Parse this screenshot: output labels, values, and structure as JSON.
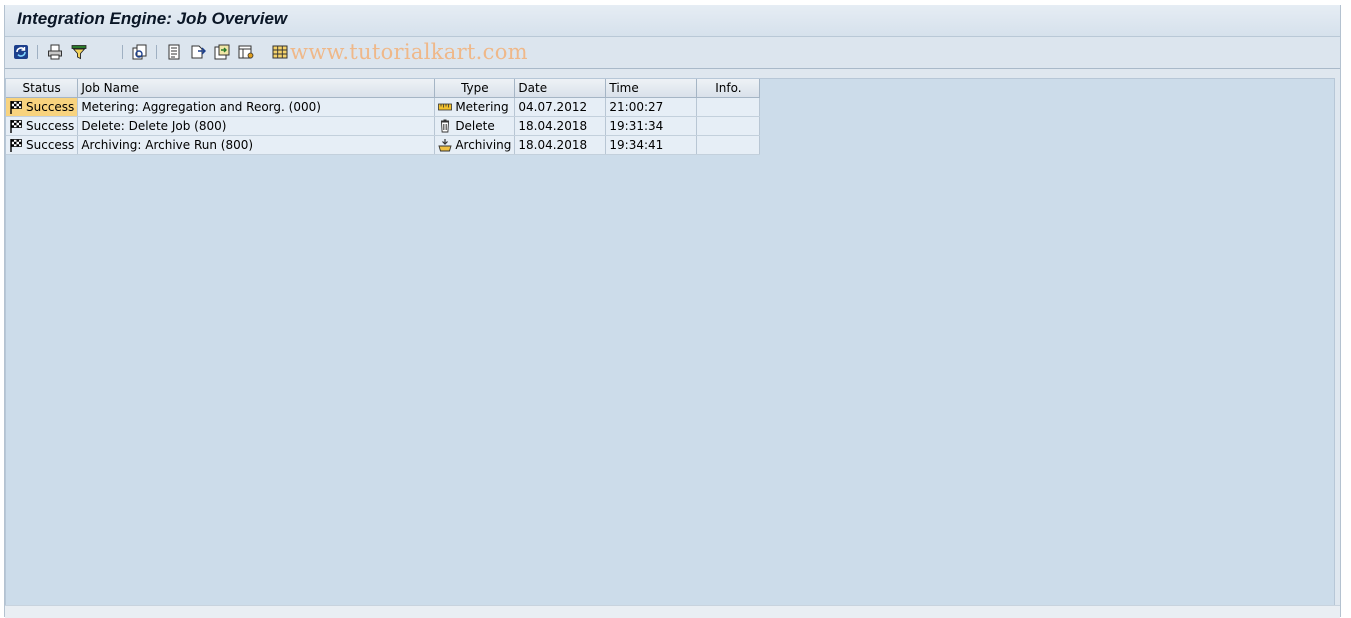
{
  "window": {
    "title": "Integration Engine: Job Overview"
  },
  "toolbar": {
    "buttons": [
      {
        "name": "refresh-button",
        "icon": "refresh-icon"
      },
      {
        "name": "print-button",
        "icon": "print-icon"
      },
      {
        "name": "filter-button",
        "icon": "filter-icon"
      },
      {
        "name": "details-button",
        "icon": "details-icon"
      },
      {
        "name": "job-log-button",
        "icon": "document-icon"
      },
      {
        "name": "export-button",
        "icon": "export-icon"
      },
      {
        "name": "save-local-button",
        "icon": "save-local-icon"
      },
      {
        "name": "layout-button",
        "icon": "layout-icon"
      },
      {
        "name": "grid-view-button",
        "icon": "grid-icon"
      }
    ]
  },
  "watermark": "www.tutorialkart.com",
  "table": {
    "columns": [
      "Status",
      "Job Name",
      "Type",
      "Date",
      "Time",
      "Info."
    ],
    "rows": [
      {
        "status": "Success",
        "job_name": "Metering: Aggregation and Reorg. (000)",
        "type": "Metering",
        "date": "04.07.2012",
        "time": "21:00:27",
        "info": "",
        "type_icon": "ruler-icon"
      },
      {
        "status": "Success",
        "job_name": "Delete: Delete Job (800)",
        "type": "Delete",
        "date": "18.04.2018",
        "time": "19:31:34",
        "info": "",
        "type_icon": "trash-icon"
      },
      {
        "status": "Success",
        "job_name": "Archiving: Archive Run (800)",
        "type": "Archiving",
        "date": "18.04.2018",
        "time": "19:34:41",
        "info": "",
        "type_icon": "archive-icon"
      }
    ]
  },
  "colors": {
    "selected_cell": "#f8d37e",
    "content_background": "#ccdcea",
    "watermark": "#efb889"
  }
}
